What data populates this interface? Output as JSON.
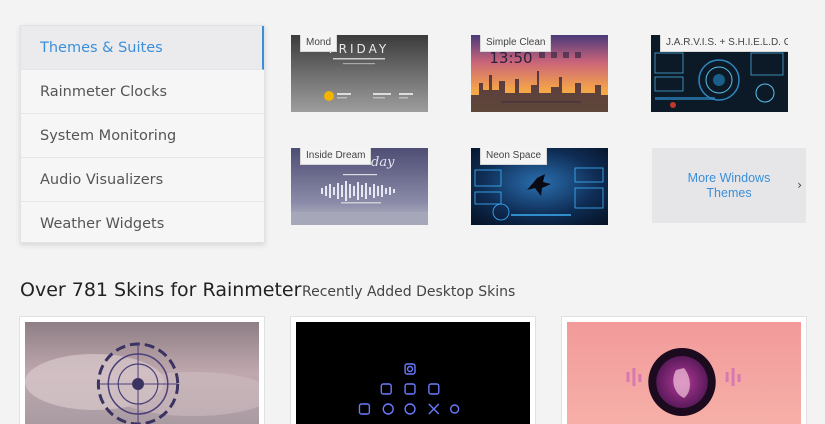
{
  "sidebar": {
    "items": [
      {
        "label": "Themes & Suites",
        "active": true
      },
      {
        "label": "Rainmeter Clocks"
      },
      {
        "label": "System Monitoring"
      },
      {
        "label": "Audio Visualizers"
      },
      {
        "label": "Weather Widgets"
      }
    ]
  },
  "themes": {
    "mond": {
      "label": "Mond",
      "clock_text": "FRIDAY"
    },
    "simple_clean": {
      "label": "Simple Clean",
      "time_text": "13:50"
    },
    "jarvis": {
      "label": "J.A.R.V.I.S. + S.H.I.E.L.D. OS"
    },
    "inside_dream": {
      "label": "Inside Dream",
      "script_text": "day"
    },
    "neon_space": {
      "label": "Neon Space"
    },
    "more": {
      "label": "More Windows Themes",
      "icon": "chevron-right-icon"
    }
  },
  "section": {
    "title": "Over 781 Skins for Rainmeter",
    "subtitle": "Recently Added Desktop Skins"
  },
  "colors": {
    "accent": "#3b8fd9",
    "background": "#f3f3f4"
  }
}
